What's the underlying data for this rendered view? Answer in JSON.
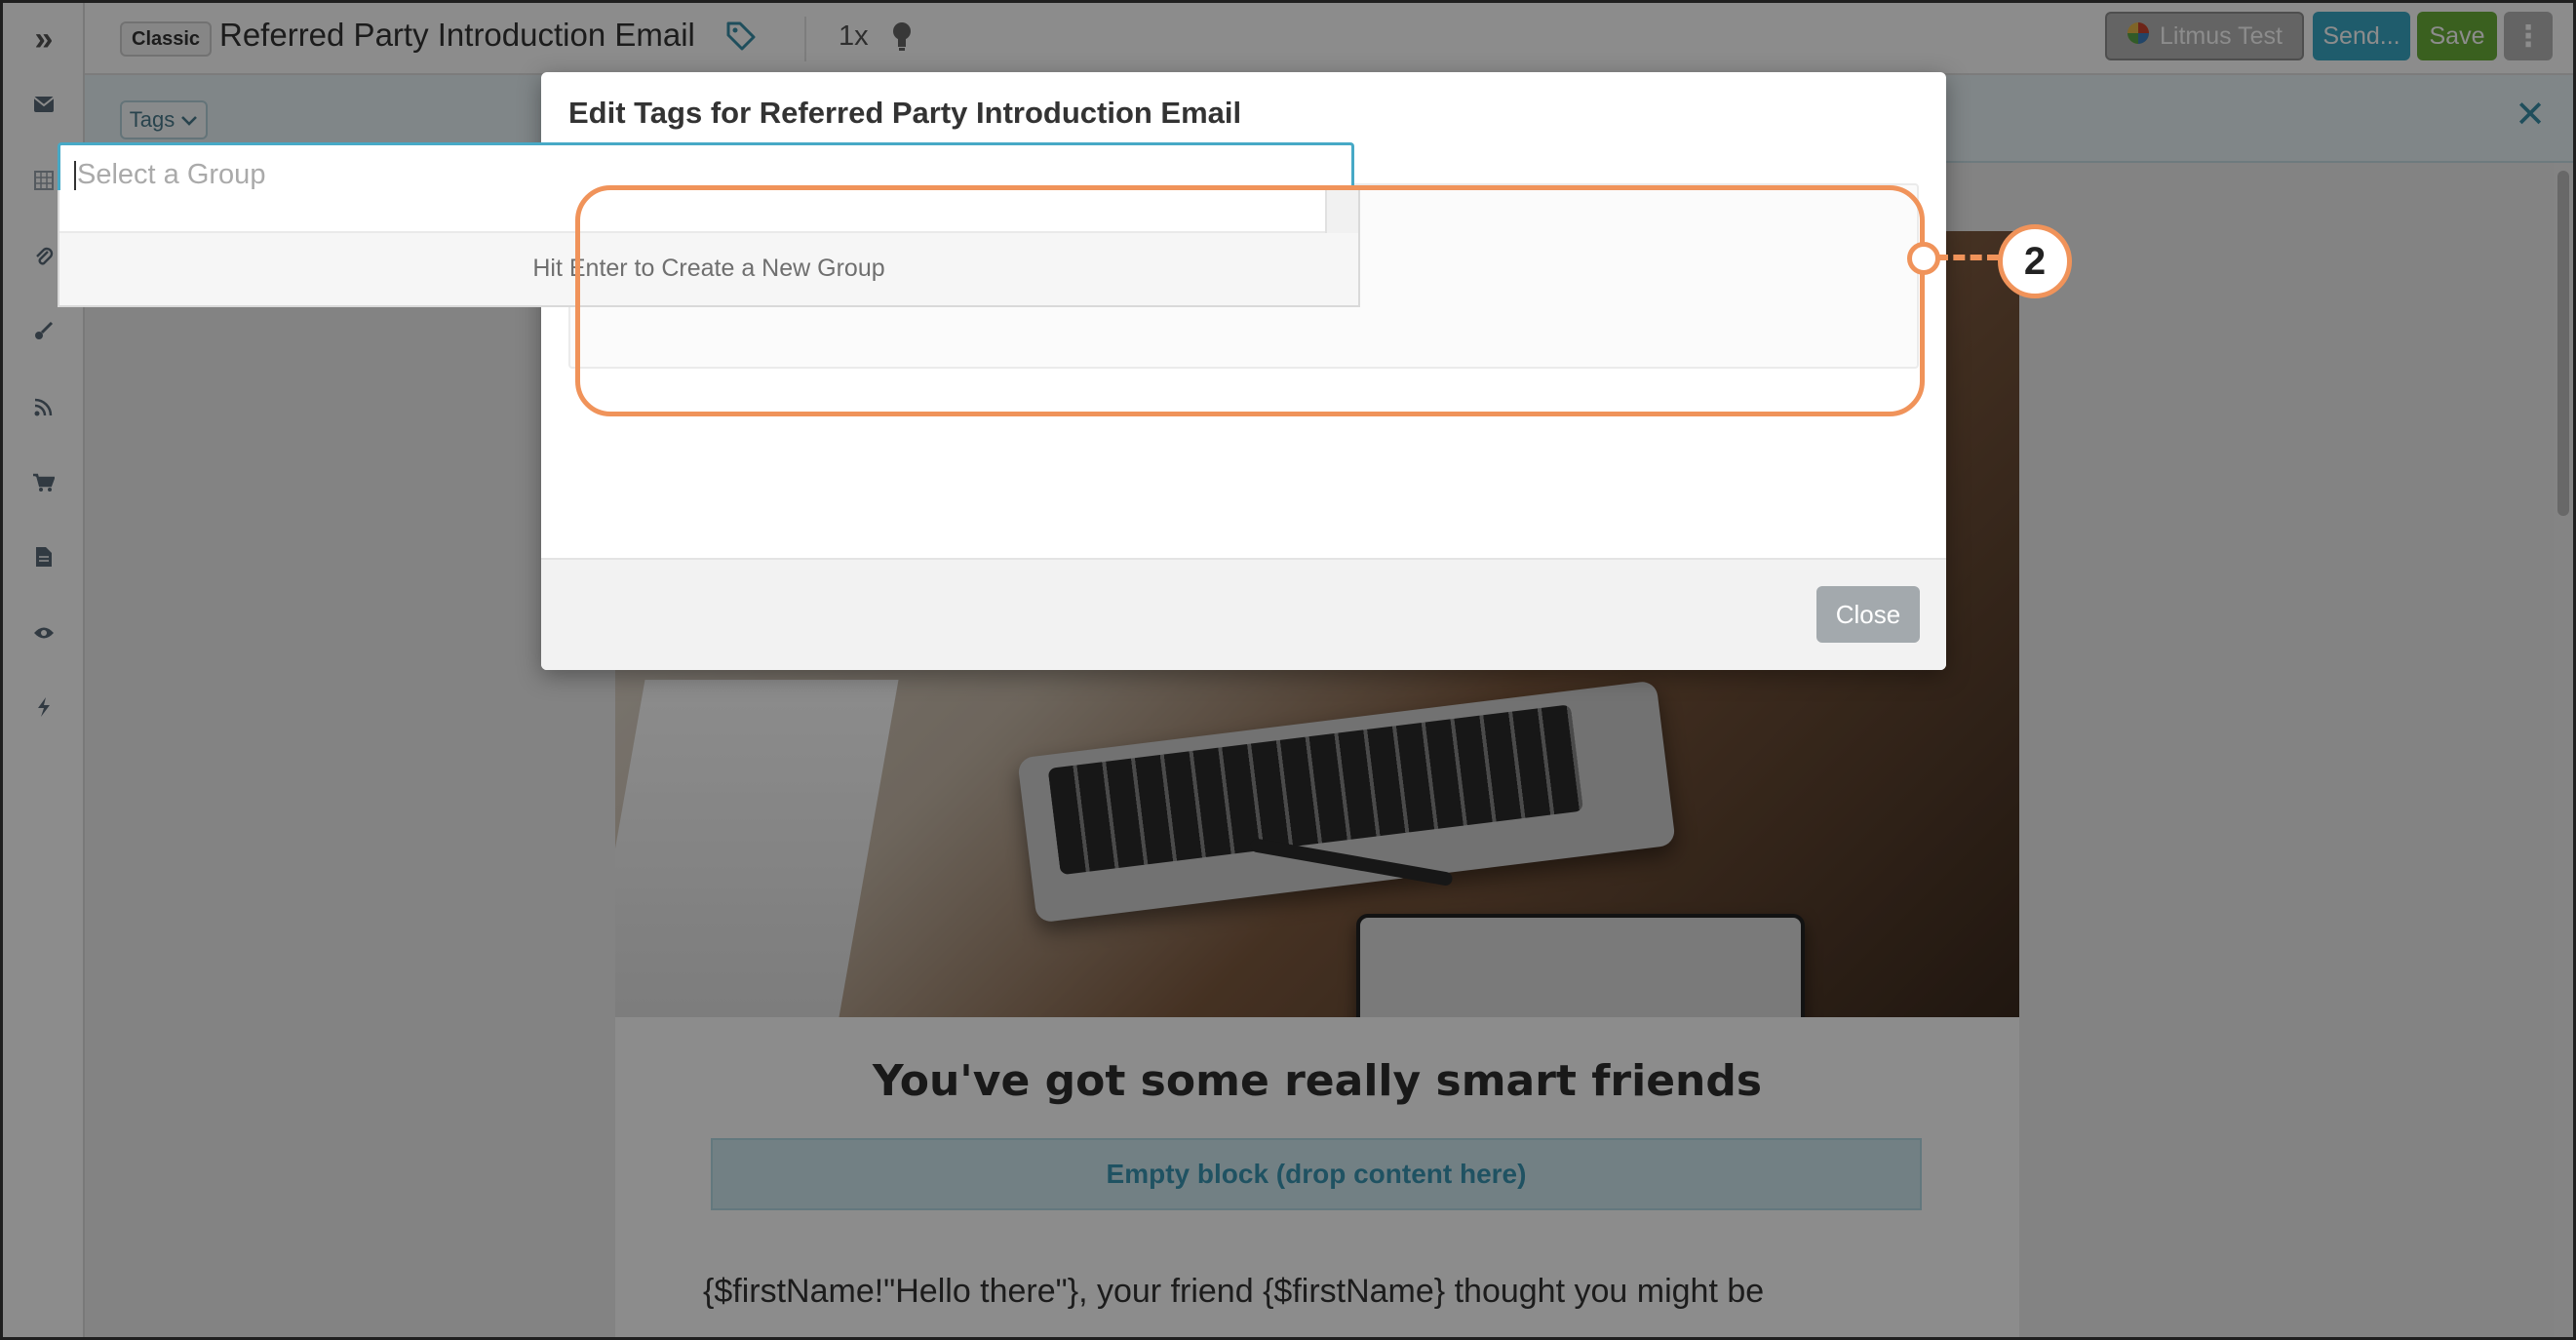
{
  "sidebar": {
    "toggle_glyph": "»",
    "items": [
      {
        "icon": "envelope-icon"
      },
      {
        "icon": "grid-icon"
      },
      {
        "icon": "paperclip-icon"
      },
      {
        "icon": "brush-icon"
      },
      {
        "icon": "rss-icon"
      },
      {
        "icon": "cart-icon"
      },
      {
        "icon": "document-icon"
      },
      {
        "icon": "eye-icon"
      },
      {
        "icon": "bolt-icon"
      }
    ]
  },
  "topbar": {
    "badge": "Classic",
    "title": "Referred Party Introduction Email",
    "zoom": "1x",
    "litmus_label": "Litmus Test",
    "send_label": "Send...",
    "save_label": "Save",
    "more_glyph": "⋮"
  },
  "tagsbar": {
    "dropdown_label": "Tags",
    "close_glyph": "✕"
  },
  "email": {
    "heading": "You've got some really smart friends",
    "empty_block": "Empty block (drop content here)",
    "body_line": "{$firstName!\"Hello there\"}, your friend {$firstName} thought you might be"
  },
  "modal": {
    "title": "Edit Tags for Referred Party Introduction Email",
    "select_placeholder": "Select a Group",
    "dropdown_hint": "Hit Enter to Create a New Group",
    "close_label": "Close"
  },
  "annotation": {
    "step_number": "2",
    "color": "#f0935a"
  },
  "colors": {
    "accent_teal": "#3aa8c5",
    "save_green": "#6ab03a",
    "focus_border": "#47a9c6"
  }
}
